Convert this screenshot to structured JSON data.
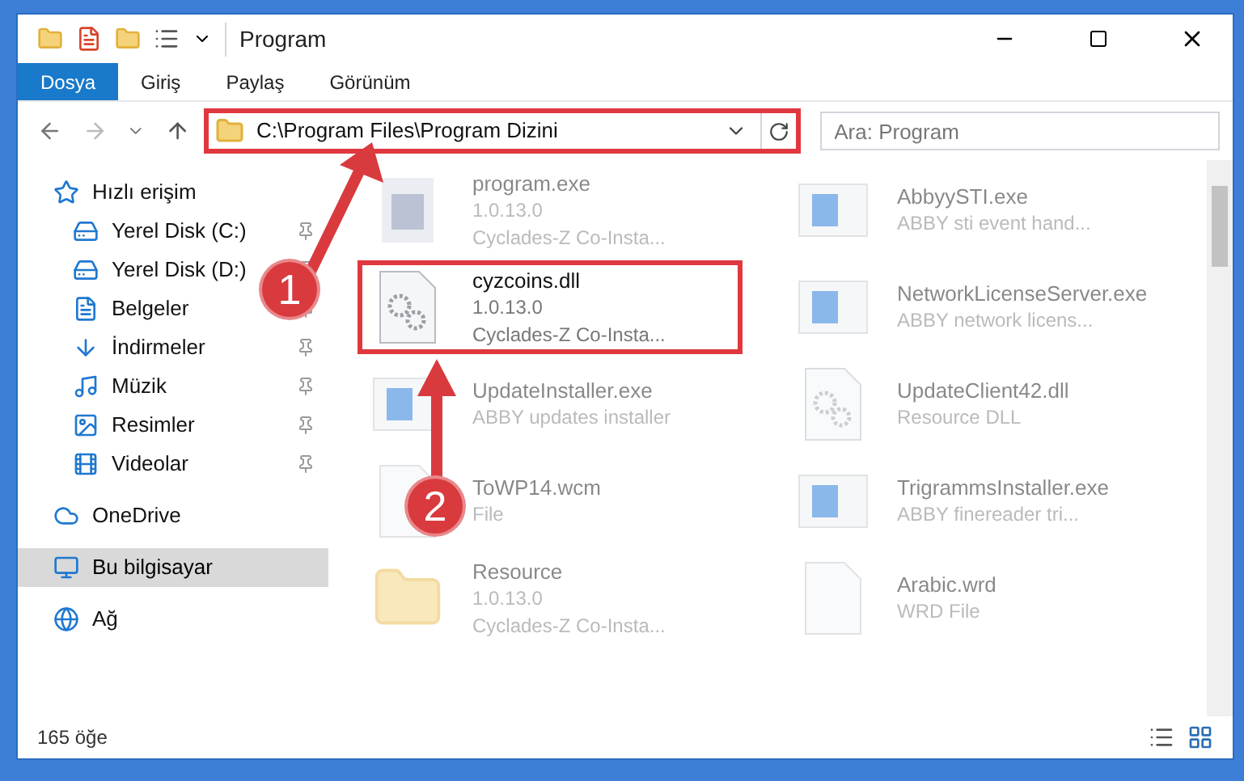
{
  "window": {
    "title": "Program"
  },
  "ribbon_tabs": [
    {
      "label": "Dosya",
      "selected": true
    },
    {
      "label": "Giriş",
      "selected": false
    },
    {
      "label": "Paylaş",
      "selected": false
    },
    {
      "label": "Görünüm",
      "selected": false
    }
  ],
  "address": {
    "path": "C:\\Program Files\\Program Dizini",
    "highlighted": true
  },
  "search": {
    "placeholder": "Ara: Program"
  },
  "nav": {
    "items": [
      {
        "label": "Hızlı erişim",
        "kind": "star",
        "selected": false,
        "children": [
          {
            "label": "Yerel Disk (C:)",
            "kind": "drive",
            "pinned": true,
            "selected": false
          },
          {
            "label": "Yerel Disk (D:)",
            "kind": "drive",
            "pinned": true,
            "selected": false
          },
          {
            "label": "Belgeler",
            "kind": "docs",
            "pinned": true,
            "selected": false
          },
          {
            "label": "İndirmeler",
            "kind": "download",
            "pinned": true,
            "selected": false
          },
          {
            "label": "Müzik",
            "kind": "music",
            "pinned": true,
            "selected": false
          },
          {
            "label": "Resimler",
            "kind": "pictures",
            "pinned": true,
            "selected": false
          },
          {
            "label": "Videolar",
            "kind": "video",
            "pinned": true,
            "selected": false
          }
        ]
      },
      {
        "label": "OneDrive",
        "kind": "cloud",
        "selected": false
      },
      {
        "label": "Bu bilgisayar",
        "kind": "pc",
        "selected": true
      },
      {
        "label": "Ağ",
        "kind": "network",
        "selected": false
      }
    ]
  },
  "files": [
    {
      "name": "program.exe",
      "lines": [
        "1.0.13.0",
        "Cyclades-Z Co-Insta..."
      ],
      "kind": "app",
      "highlighted": false,
      "blurred": true
    },
    {
      "name": "AbbyySTI.exe",
      "lines": [
        "ABBY sti event hand..."
      ],
      "kind": "window",
      "highlighted": false,
      "blurred": true
    },
    {
      "name": "cyzcoins.dll",
      "lines": [
        "1.0.13.0",
        "Cyclades-Z Co-Insta..."
      ],
      "kind": "gear",
      "highlighted": true,
      "blurred": false
    },
    {
      "name": "NetworkLicenseServer.exe",
      "lines": [
        "ABBY network licens..."
      ],
      "kind": "window",
      "highlighted": false,
      "blurred": true
    },
    {
      "name": "UpdateInstaller.exe",
      "lines": [
        "ABBY updates installer"
      ],
      "kind": "window",
      "highlighted": false,
      "blurred": true
    },
    {
      "name": "UpdateClient42.dll",
      "lines": [
        "Resource DLL"
      ],
      "kind": "gear",
      "highlighted": false,
      "blurred": true
    },
    {
      "name": "ToWP14.wcm",
      "lines": [
        "File"
      ],
      "kind": "blank",
      "highlighted": false,
      "blurred": true
    },
    {
      "name": "TrigrammsInstaller.exe",
      "lines": [
        "ABBY finereader tri..."
      ],
      "kind": "window",
      "highlighted": false,
      "blurred": true
    },
    {
      "name": "Resource",
      "lines": [
        "1.0.13.0",
        "Cyclades-Z Co-Insta..."
      ],
      "kind": "folder",
      "highlighted": false,
      "blurred": true
    },
    {
      "name": "Arabic.wrd",
      "lines": [
        "WRD File"
      ],
      "kind": "blank",
      "highlighted": false,
      "blurred": true
    }
  ],
  "status_bar": {
    "count": "165 öğe"
  },
  "annotations": [
    {
      "number": "1"
    },
    {
      "number": "2"
    }
  ]
}
